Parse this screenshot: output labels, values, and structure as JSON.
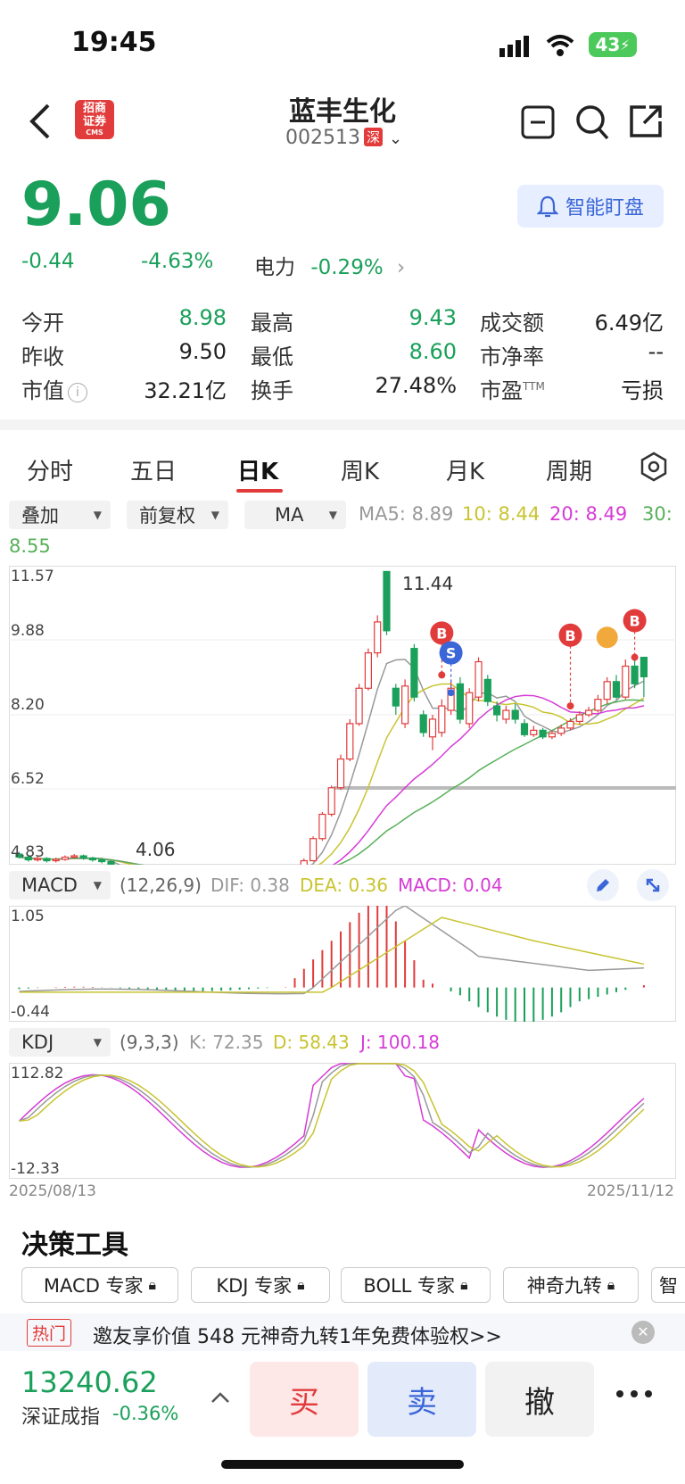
{
  "status": {
    "time": "19:45",
    "battery": "43"
  },
  "header": {
    "logo_line1": "招商",
    "logo_line2": "证券",
    "logo_sub": "CMS",
    "title": "蓝丰生化",
    "code": "002513",
    "market_tag": "深"
  },
  "quote": {
    "price": "9.06",
    "change": "-0.44",
    "change_pct": "-4.63%",
    "sector_label": "电力",
    "sector_pct": "-0.29%",
    "smart_button": "智能盯盘"
  },
  "stats": [
    {
      "label": "今开",
      "value": "8.98",
      "color": "green"
    },
    {
      "label": "最高",
      "value": "9.43",
      "color": "green"
    },
    {
      "label": "成交额",
      "value": "6.49亿",
      "color": "black"
    },
    {
      "label": "昨收",
      "value": "9.50",
      "color": "black"
    },
    {
      "label": "最低",
      "value": "8.60",
      "color": "green"
    },
    {
      "label": "市净率",
      "value": "--",
      "color": "black"
    },
    {
      "label": "市值",
      "value": "32.21亿",
      "color": "black"
    },
    {
      "label": "换手",
      "value": "27.48%",
      "color": "black"
    },
    {
      "label": "市盈",
      "value": "亏损",
      "color": "black"
    }
  ],
  "stats_pe_sup": "TTM",
  "tabs": [
    "分时",
    "五日",
    "日K",
    "周K",
    "月K",
    "周期"
  ],
  "active_tab": "日K",
  "controls": {
    "overlay": "叠加",
    "adjust": "前复权",
    "indicator": "MA"
  },
  "ma": {
    "ma5": "MA5: 8.89",
    "ma10": "10: 8.44",
    "ma20": "20: 8.49",
    "ma30": "30:",
    "ma30_val": "8.55"
  },
  "colors": {
    "green": "#1aa05a",
    "red": "#e23b3b",
    "ma5": "#999999",
    "ma10": "#c8c431",
    "ma20": "#d63bd6",
    "ma30": "#58b05a",
    "blue": "#3b66d8"
  },
  "chart_data": [
    {
      "type": "candlestick",
      "title": "",
      "y_ticks": [
        "11.57",
        "9.88",
        "8.20",
        "6.52",
        "4.83"
      ],
      "ylim": [
        4.83,
        11.57
      ],
      "annotations": [
        "11.44",
        "4.06"
      ],
      "trade_markers": [
        "B",
        "S",
        "B",
        "B"
      ],
      "x_range": [
        "2025/08/13",
        "2025/11/12"
      ]
    },
    {
      "type": "line",
      "title": "MACD",
      "params": "(12,26,9)",
      "dif": "DIF: 0.38",
      "dea": "DEA: 0.36",
      "macd": "MACD: 0.04",
      "y_ticks": [
        "1.05",
        "-0.44"
      ],
      "ylim": [
        -0.44,
        1.05
      ]
    },
    {
      "type": "line",
      "title": "KDJ",
      "params": "(9,3,3)",
      "k": "K: 72.35",
      "d": "D: 58.43",
      "j": "J: 100.18",
      "y_ticks": [
        "112.82",
        "-12.33"
      ],
      "ylim": [
        -12.33,
        112.82
      ]
    }
  ],
  "dates": {
    "start": "2025/08/13",
    "end": "2025/11/12"
  },
  "tools": {
    "title": "决策工具",
    "items": [
      "MACD 专家",
      "KDJ 专家",
      "BOLL 专家",
      "神奇九转",
      "智"
    ]
  },
  "promo": {
    "tag": "热门",
    "text": "邀友享价值 548 元神奇九转1年免费体验权>>"
  },
  "bottom": {
    "index_value": "13240.62",
    "index_name": "深证成指",
    "index_pct": "-0.36%",
    "buy": "买",
    "sell": "卖",
    "cancel": "撤"
  }
}
